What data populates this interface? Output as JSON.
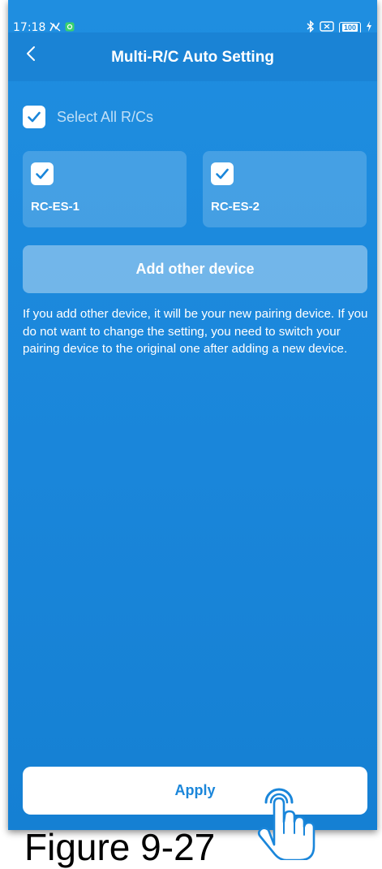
{
  "status_bar": {
    "time": "17:18",
    "battery": "100"
  },
  "header": {
    "title": "Multi-R/C Auto Setting"
  },
  "select_all": {
    "label": "Select All R/Cs",
    "checked": true
  },
  "rc_list": [
    {
      "label": "RC-ES-1",
      "checked": true
    },
    {
      "label": "RC-ES-2",
      "checked": true
    }
  ],
  "add_device_label": "Add other device",
  "info_text": "If you add other device, it will be your new pairing device. If you do not want to change the setting, you need to switch your pairing device to the original one after adding a new device.",
  "apply_label": "Apply",
  "caption": "Figure 9-27",
  "colors": {
    "background": "#1a86da",
    "accent": "#1a86da",
    "surface": "#ffffff"
  }
}
